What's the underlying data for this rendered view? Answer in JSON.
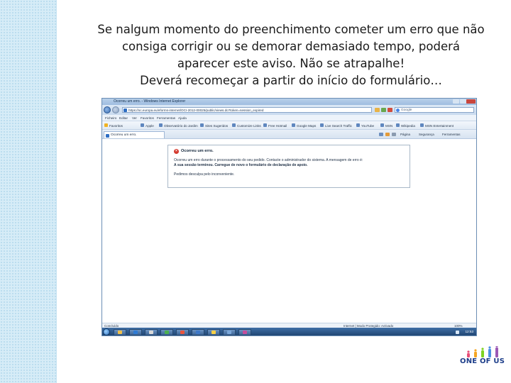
{
  "caption": {
    "line1": "Se nalgum momento do preenchimento cometer um erro que não",
    "line2": "consiga corrigir ou se demorar demasiado tempo,  poderá",
    "line3": "aparecer este aviso. Não se atrapalhe!",
    "line4": "Deverá recomeçar a partir do início do formulário…"
  },
  "browser": {
    "window_title": "Ocorreu um erro. - Windows Internet Explorer",
    "url": "https://oc.europa.eu/eforms-internet/OCI-2012-00025/public/views.do?token=session_expired",
    "search_placeholder": "Google",
    "menu": [
      "Ficheiro",
      "Editar",
      "Ver",
      "Favoritos",
      "Ferramentas",
      "Ajuda"
    ],
    "favorites_label": "Favoritos",
    "favorites": [
      "Apple",
      "Observatório do Jardim",
      "Sites Sugeridos",
      "Customize Links",
      "Free Hotmail",
      "Google Maps",
      "Live Search Traffic",
      "YouTube",
      "MSN",
      "Wikipedia",
      "MSN Entertainment"
    ],
    "tab_label": "Ocorreu um erro.",
    "commands": [
      "Página",
      "Segurança",
      "Ferramentas"
    ],
    "error": {
      "title": "Ocorreu um erro.",
      "line1": "Ocorreu um erro durante o processamento do seu pedido. Contacte o administrador do sistema. A mensagem de erro é:",
      "line2": "A sua sessão terminou. Carregue de novo o formulário de declaração de apoio.",
      "line3": "Pedimos desculpa pelo inconveniente."
    },
    "status": {
      "left": "Concluído",
      "zone": "Internet | Modo Protegido: Activado",
      "zoom": "100%"
    },
    "clock": "12:53"
  },
  "logo": {
    "text": "ONE OF US",
    "colors": [
      "#e94e77",
      "#f5a623",
      "#7ed321",
      "#4a90e2",
      "#9b59b6"
    ]
  }
}
